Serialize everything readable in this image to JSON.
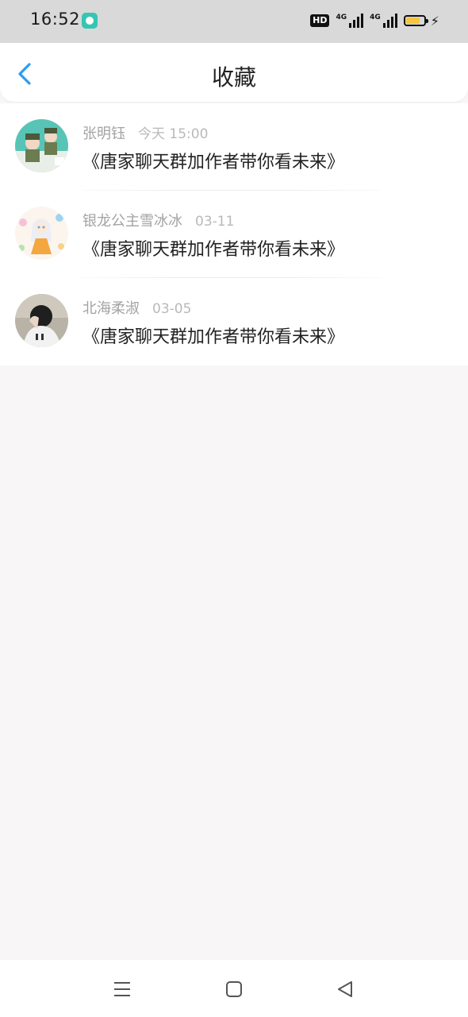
{
  "status_bar": {
    "time": "16:52",
    "hd_label": "HD",
    "sim1_label": "4G",
    "sim2_label": "4G",
    "battery_level": 0.65,
    "charging": true
  },
  "header": {
    "title": "收藏"
  },
  "favorites": [
    {
      "sender": "张明钰",
      "time": "今天 15:00",
      "content": "《唐家聊天群加作者带你看未来》"
    },
    {
      "sender": "银龙公主雪冰冰",
      "time": "03-11",
      "content": "《唐家聊天群加作者带你看未来》"
    },
    {
      "sender": "北海柔淑",
      "time": "03-05",
      "content": "《唐家聊天群加作者带你看未来》"
    }
  ],
  "colors": {
    "accent": "#2a9df4",
    "status_bar_bg": "#d9d9d9",
    "page_bg": "#f8f6f7"
  },
  "icons": {
    "back": "chevron-left-icon",
    "menu": "menu-icon",
    "home": "home-square-icon",
    "back_nav": "triangle-back-icon"
  }
}
